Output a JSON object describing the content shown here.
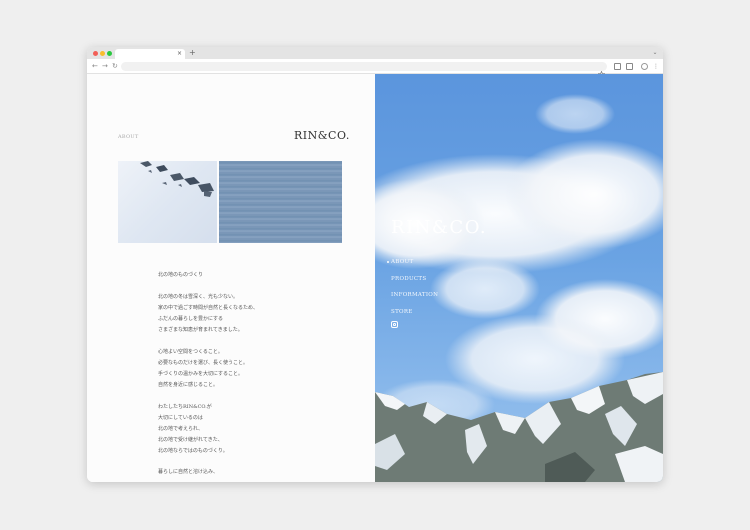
{
  "site": {
    "brand": "RIN&CO.",
    "section_label": "ABOUT"
  },
  "nav": {
    "items": [
      {
        "label": "ABOUT",
        "active": true
      },
      {
        "label": "PRODUCTS",
        "active": false
      },
      {
        "label": "INFORMATION",
        "active": false
      },
      {
        "label": "STORE",
        "active": false
      }
    ],
    "social_icon": "instagram-icon"
  },
  "about": {
    "heading": "北の地のものづくり",
    "paragraphs": [
      [
        "北の地の冬は雪深く、光も少ない。",
        "家の中で過ごす時間が自然と長くなるため、",
        "ふだんの暮らしを豊かにする",
        "さまざまな知恵が育まれてきました。"
      ],
      [
        "心地よい空間をつくること。",
        "必要なものだけを選び、長く使うこと。",
        "手づくりの温かみを大切にすること。",
        "自然を身近に感じること。"
      ],
      [
        "わたしたちRIN&CO.が",
        "大切にしているのは",
        "北の地で考えられ、",
        "北の地で受け継がれてきた、",
        "北の地ならではのものづくり。"
      ],
      [
        "暮らしに自然と溶け込み、"
      ]
    ]
  },
  "browser": {
    "tab_close": "×",
    "new_tab": "+",
    "back": "←",
    "forward": "→",
    "reload": "↻"
  }
}
